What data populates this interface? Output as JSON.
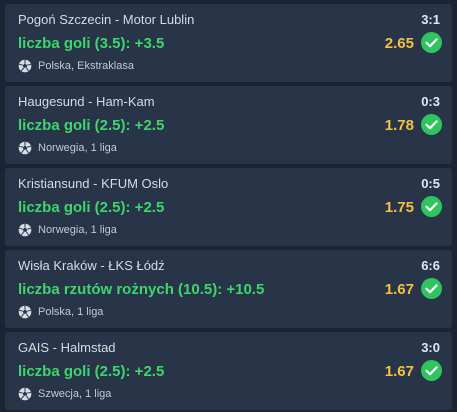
{
  "bets": [
    {
      "match": "Pogoń Szczecin - Motor Lublin",
      "score": "3:1",
      "market": "liczba goli (3.5): +3.5",
      "odds": "2.65",
      "league": "Polska, Ekstraklasa",
      "status_icon": "check-circle-icon",
      "sport_icon": "football-icon"
    },
    {
      "match": "Haugesund - Ham-Kam",
      "score": "0:3",
      "market": "liczba goli (2.5): +2.5",
      "odds": "1.78",
      "league": "Norwegia, 1 liga",
      "status_icon": "check-circle-icon",
      "sport_icon": "football-icon"
    },
    {
      "match": "Kristiansund - KFUM Oslo",
      "score": "0:5",
      "market": "liczba goli (2.5): +2.5",
      "odds": "1.75",
      "league": "Norwegia, 1 liga",
      "status_icon": "check-circle-icon",
      "sport_icon": "football-icon"
    },
    {
      "match": "Wisła Kraków - ŁKS Łódź",
      "score": "6:6",
      "market": "liczba rzutów rożnych (10.5): +10.5",
      "odds": "1.67",
      "league": "Polska, 1 liga",
      "status_icon": "check-circle-icon",
      "sport_icon": "football-icon"
    },
    {
      "match": "GAIS - Halmstad",
      "score": "3:0",
      "market": "liczba goli (2.5): +2.5",
      "odds": "1.67",
      "league": "Szwecja, 1 liga",
      "status_icon": "check-circle-icon",
      "sport_icon": "football-icon"
    }
  ],
  "colors": {
    "background": "#1b2433",
    "card": "#283548",
    "market_green": "#3ed56d",
    "odds_yellow": "#f3c340",
    "check_green": "#2fc45e"
  }
}
